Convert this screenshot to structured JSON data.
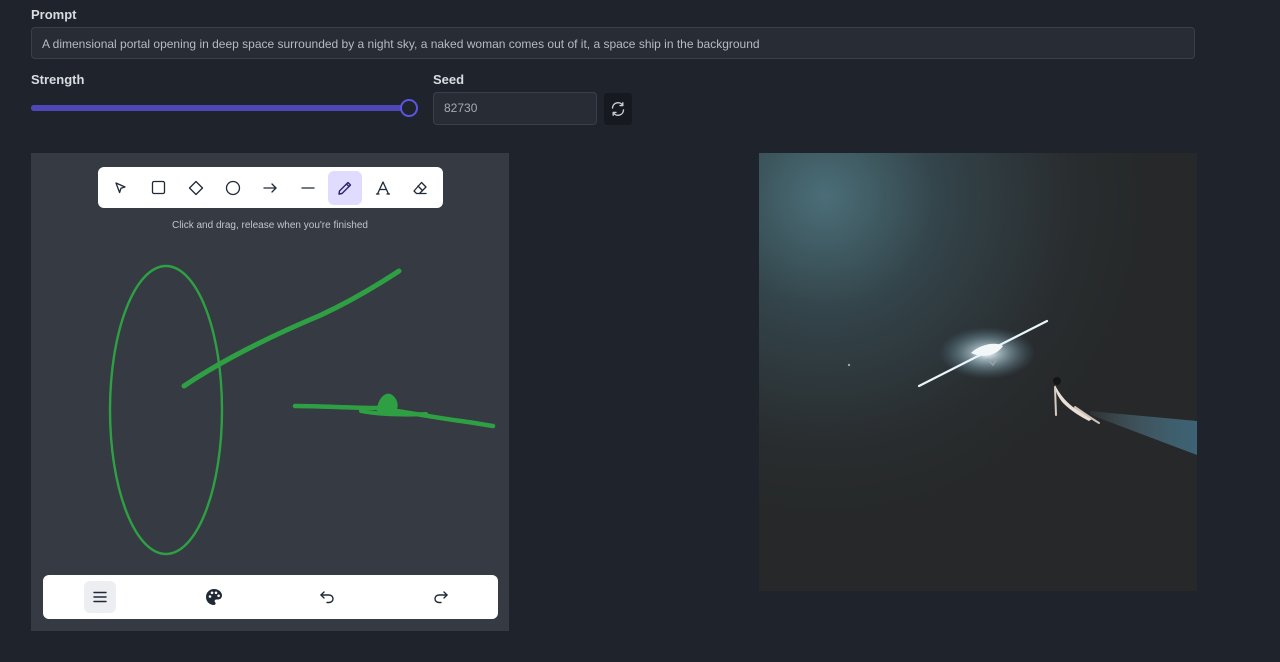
{
  "prompt": {
    "label": "Prompt",
    "value": "A dimensional portal opening in deep space surrounded by a night sky, a naked woman comes out of it, a space ship in the background"
  },
  "strength": {
    "label": "Strength",
    "value": 1.0
  },
  "seed": {
    "label": "Seed",
    "value": "82730"
  },
  "canvas": {
    "hint": "Click and drag, release when you're finished",
    "tools": [
      {
        "name": "selection-icon",
        "active": false
      },
      {
        "name": "rectangle-icon",
        "active": false
      },
      {
        "name": "diamond-icon",
        "active": false
      },
      {
        "name": "ellipse-icon",
        "active": false
      },
      {
        "name": "arrow-icon",
        "active": false
      },
      {
        "name": "line-icon",
        "active": false
      },
      {
        "name": "pencil-icon",
        "active": true
      },
      {
        "name": "text-icon",
        "active": false
      },
      {
        "name": "eraser-icon",
        "active": false
      }
    ],
    "stroke_color": "#2ea043",
    "bottom_tools": [
      "menu-icon",
      "palette-icon",
      "undo-icon",
      "redo-icon"
    ]
  },
  "colors": {
    "accent": "#5b55e0",
    "background": "#1f232b"
  }
}
